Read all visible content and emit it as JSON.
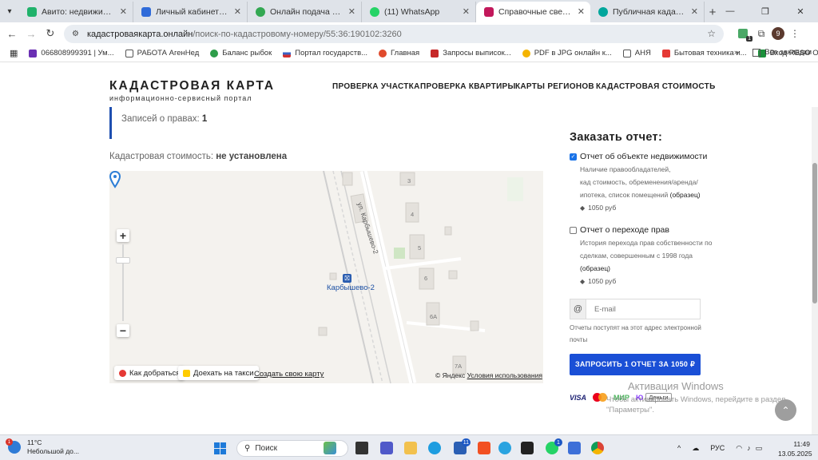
{
  "browser": {
    "tabs": [
      {
        "label": "Авито: недвижимость, тр",
        "color": "#20b26b",
        "active": false
      },
      {
        "label": "Личный кабинет — ЦИАН",
        "color": "#2f6bd9",
        "active": false
      },
      {
        "label": "Онлайн подача заявки на",
        "color": "#33a852",
        "active": false
      },
      {
        "label": "(11) WhatsApp",
        "color": "#25d366",
        "active": false
      },
      {
        "label": "Справочные сведения из",
        "color": "#c2185b",
        "active": true
      },
      {
        "label": "Публичная кадастровая к",
        "color": "#00a69c",
        "active": false
      }
    ],
    "url_host": "кадастроваякарта.онлайн",
    "url_path": "/поиск-по-кадастровому-номеру/55:36:190102:3260",
    "ext_badge": "1",
    "avatar_letter": "9",
    "bookmarks": [
      {
        "label": "066808999391 | Ум...",
        "color": "#6a2fb3"
      },
      {
        "label": "РАБОТА АгенНед",
        "color": "#8a8a8a"
      },
      {
        "label": "Баланс рыбок",
        "color": "#2e9d4a"
      },
      {
        "label": "Портал государств...",
        "color": "#3b63c4"
      },
      {
        "label": "Главная",
        "color": "#e04a2c"
      },
      {
        "label": "Запросы выписок...",
        "color": "#c62828"
      },
      {
        "label": "PDF в JPG онлайн к...",
        "color": "#f4b400"
      },
      {
        "label": "АНЯ",
        "color": "#8a8a8a"
      },
      {
        "label": "Бытовая техника и...",
        "color": "#e53935"
      },
      {
        "label": "Вход RESO Office",
        "color": "#1b8f3a"
      }
    ],
    "bookmarks_more": "»",
    "all_bookmarks": "Все закладки"
  },
  "site": {
    "logo_title": "КАДАСТРОВАЯ КАРТА",
    "logo_sub": "информационно-сервисный портал",
    "nav": [
      "ПРОВЕРКА УЧАСТКА",
      "ПРОВЕРКА КВАРТИРЫ",
      "КАРТЫ РЕГИОНОВ",
      "КАДАСТРОВАЯ СТОИМОСТЬ"
    ]
  },
  "content": {
    "rights_label": "Записей о правах:",
    "rights_value": "1",
    "cost_label": "Кадастровая стоимость:",
    "cost_value": "не установлена"
  },
  "map": {
    "street": "ул. Карбышево-2",
    "station": "Карбышево-2",
    "house_numbers": [
      "3",
      "4",
      "5",
      "6",
      "6А",
      "7А"
    ],
    "zoom_in": "+",
    "zoom_out": "−",
    "route_btn": "Как добраться",
    "taxi_btn": "Доехать на такси",
    "create_link": "Создать свою карту",
    "copyright": "© Яндекс",
    "terms": "Условия использования"
  },
  "order": {
    "title": "Заказать отчет:",
    "option1": {
      "label": "Отчет об объекте недвижимости",
      "desc1": "Наличие правообладателей,",
      "desc2": "кад стоимость, обременения/аренда/",
      "desc3": "ипотека, список помещений",
      "sample": "(образец)",
      "price": "1050 руб",
      "checked": true
    },
    "option2": {
      "label": "Отчет о переходе прав",
      "desc1": "История перехода прав собственности по",
      "desc2": "сделкам, совершенным с 1998 года",
      "sample": "(образец)",
      "price": "1050 руб",
      "checked": false
    },
    "email_prefix": "@",
    "email_placeholder": "E-mail",
    "email_note": "Отчеты поступят на этот адрес электронной почты",
    "button": "ЗАПРОСИТЬ 1 ОТЧЕТ ЗА 1050 ₽",
    "payments": [
      "VISA",
      "МИР",
      "Ю",
      "Деньги"
    ],
    "scroll_top": "⌃"
  },
  "watermark": {
    "line1": "Активация Windows",
    "line2": "Чтобы активировать Windows, перейдите в раздел",
    "line3": "\"Параметры\"."
  },
  "taskbar": {
    "temp": "11°C",
    "weather": "Небольшой до...",
    "weather_badge": "1",
    "search": "Поиск",
    "teams_badge": "11",
    "whatsapp_badge": "1",
    "lang": "РУС",
    "time": "11:49",
    "date": "13.05.2025"
  }
}
